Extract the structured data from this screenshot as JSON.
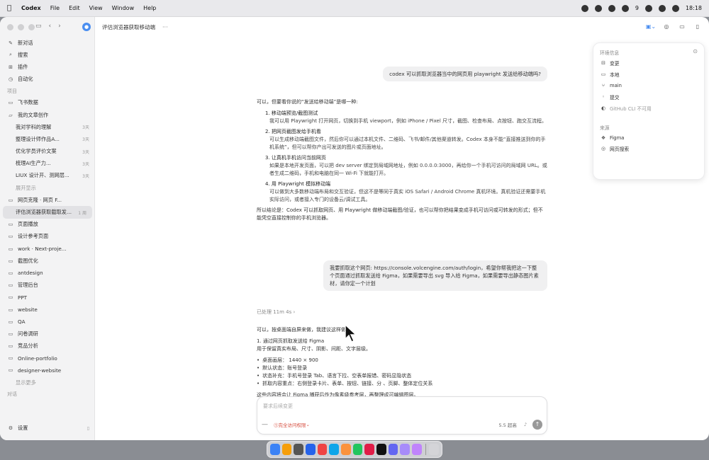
{
  "menubar": {
    "app": "Codex",
    "menus": [
      "File",
      "Edit",
      "View",
      "Window",
      "Help"
    ],
    "badge_count": "9",
    "time": "18:18"
  },
  "sidebar": {
    "top_items": [
      {
        "label": "新对话",
        "icon": "edit-icon"
      },
      {
        "label": "搜索",
        "icon": "search-icon"
      },
      {
        "label": "插件",
        "icon": "plugin-icon"
      },
      {
        "label": "自动化",
        "icon": "clock-icon"
      }
    ],
    "projects_label": "项目",
    "projects": [
      {
        "label": "飞书数据",
        "kind": "folder"
      },
      {
        "label": "我的文章创作",
        "kind": "folder-open"
      },
      {
        "label": "我对学科的理解",
        "meta": "3天",
        "kind": "chat"
      },
      {
        "label": "整理设计师作品A...",
        "meta": "3天",
        "kind": "chat"
      },
      {
        "label": "优化学员评价文案",
        "meta": "3天",
        "kind": "chat"
      },
      {
        "label": "梳理AI生产力...",
        "meta": "3天",
        "kind": "chat"
      },
      {
        "label": "LIUX 设计开、测网层...",
        "meta": "3天",
        "kind": "chat"
      },
      {
        "label": "展开显示",
        "kind": "more"
      },
      {
        "label": "网页克隆 · 网页 F...",
        "kind": "folder"
      },
      {
        "label": "评估浏览器获取截取发送移动端",
        "meta": "1 周",
        "kind": "active"
      },
      {
        "label": "页面播放",
        "kind": "folder"
      },
      {
        "label": "设计参考页面",
        "kind": "folder"
      },
      {
        "label": "work · Next-proje...",
        "kind": "folder"
      },
      {
        "label": "截图优化",
        "kind": "folder"
      },
      {
        "label": "antdesign",
        "kind": "folder"
      },
      {
        "label": "管理后台",
        "kind": "folder"
      },
      {
        "label": "PPT",
        "kind": "folder"
      },
      {
        "label": "website",
        "kind": "folder"
      },
      {
        "label": "QA",
        "kind": "folder"
      },
      {
        "label": "问卷调研",
        "kind": "folder"
      },
      {
        "label": "竞品分析",
        "kind": "folder"
      },
      {
        "label": "Online-portfolio",
        "kind": "folder"
      },
      {
        "label": "designer-website",
        "kind": "folder"
      },
      {
        "label": "显示更多",
        "kind": "more"
      }
    ],
    "chats_label": "对话",
    "settings_label": "设置"
  },
  "main": {
    "title": "评估浏览器获取移动端",
    "more": "···",
    "msg1": "codex 可以抓取浏览器当中的网页用 playwright 发送给移动端吗?",
    "reply1": {
      "intro": "可以，但要看你说的“发送给移动端”是哪一种:",
      "items": [
        {
          "title": "1. 移动端预览/截图测试",
          "body": "我可以用 Playwright 打开网页，切换到手机 viewport，例如 iPhone / Pixel 尺寸，截图、检查布局、点按钮、跑交互流程。"
        },
        {
          "title": "2. 把网页截图发给手机看",
          "body": "可以生成移动端截图文件，然后你可以通过本机文件、二维码、飞书/邮件/其他渠道转发。Codex 本身不能“直接推送到你的手机系统”，但可以帮你产出可发送的图片或页面地址。"
        },
        {
          "title": "3. 让真机手机访问当前网页",
          "body": "如果是本地开发页面，可以把 dev server 绑定到局域网地址，例如 0.0.0.0:3000，再给你一个手机可访问的局域网 URL。或者生成二维码，手机和电脑在同一 Wi-Fi 下就能打开。"
        },
        {
          "title": "4. 用 Playwright 模拟移动端",
          "body": "可以做到大多数移动端布局和交互验证，但这不是等同于真实 iOS Safari / Android Chrome 真机环境。真机验证还需要手机实际访问，或者接入专门的设备云/调试工具。"
        }
      ],
      "conclusion": "所以结论是：Codex 可以抓取网页、用 Playwright 做移动端截图/验证，也可以帮你把结果变成手机可访问或可转发的形式；但不能凭空直接控制你的手机浏览器。"
    },
    "msg2": "我要抓取这个网页: https://console.volcengine.com/auth/login，希望你帮我把这一下整个页面通过抓取发送给 Figma，如果需要导出 svg 导入给 Figma，如果需要导出静态图片素材，请你定一个计划",
    "processed": "已处理 11m 4s",
    "reply2": {
      "intro": "可以，按桌面端自屏来做，我建议这样做:",
      "step_title": "1. 通过网页抓取发送给 Figma",
      "step_body": "用于保留真实布局、尺寸、阴影、间距、文字层级。",
      "bullets": [
        "桌面画层： 1440 × 900",
        "默认状态：账号登录",
        "状态补充：手机号登录 Tab、语言下拉、空表单报错、密码显隐状态",
        "抓取内容重点：右侧登录卡片、表单、按钮、链接、分      、页脚、整体定位关系"
      ],
      "tail": "这些内容将会让 Figma 捕获后作为像素级参考层，再整理成可编辑图层。"
    },
    "composer": {
      "placeholder": "要求后续变更",
      "permission": "完全访问权限",
      "model": "5.5 超高"
    }
  },
  "rpanel": {
    "header": "环境信息",
    "env": [
      {
        "label": "变更",
        "icon": "diff-icon"
      },
      {
        "label": "本地",
        "icon": "laptop-icon"
      },
      {
        "label": "main",
        "icon": "branch-icon"
      },
      {
        "label": "提交",
        "icon": "commit-icon"
      },
      {
        "label": "GitHub CLI 不可用",
        "icon": "github-icon"
      }
    ],
    "sources_label": "来源",
    "sources": [
      {
        "label": "Figma",
        "icon": "figma-icon"
      },
      {
        "label": "网页搜索",
        "icon": "globe-icon"
      }
    ]
  },
  "colors": {
    "accent": "#4a8ef0",
    "danger": "#d64b3c",
    "sidebar_bg": "#f3f3f4"
  }
}
